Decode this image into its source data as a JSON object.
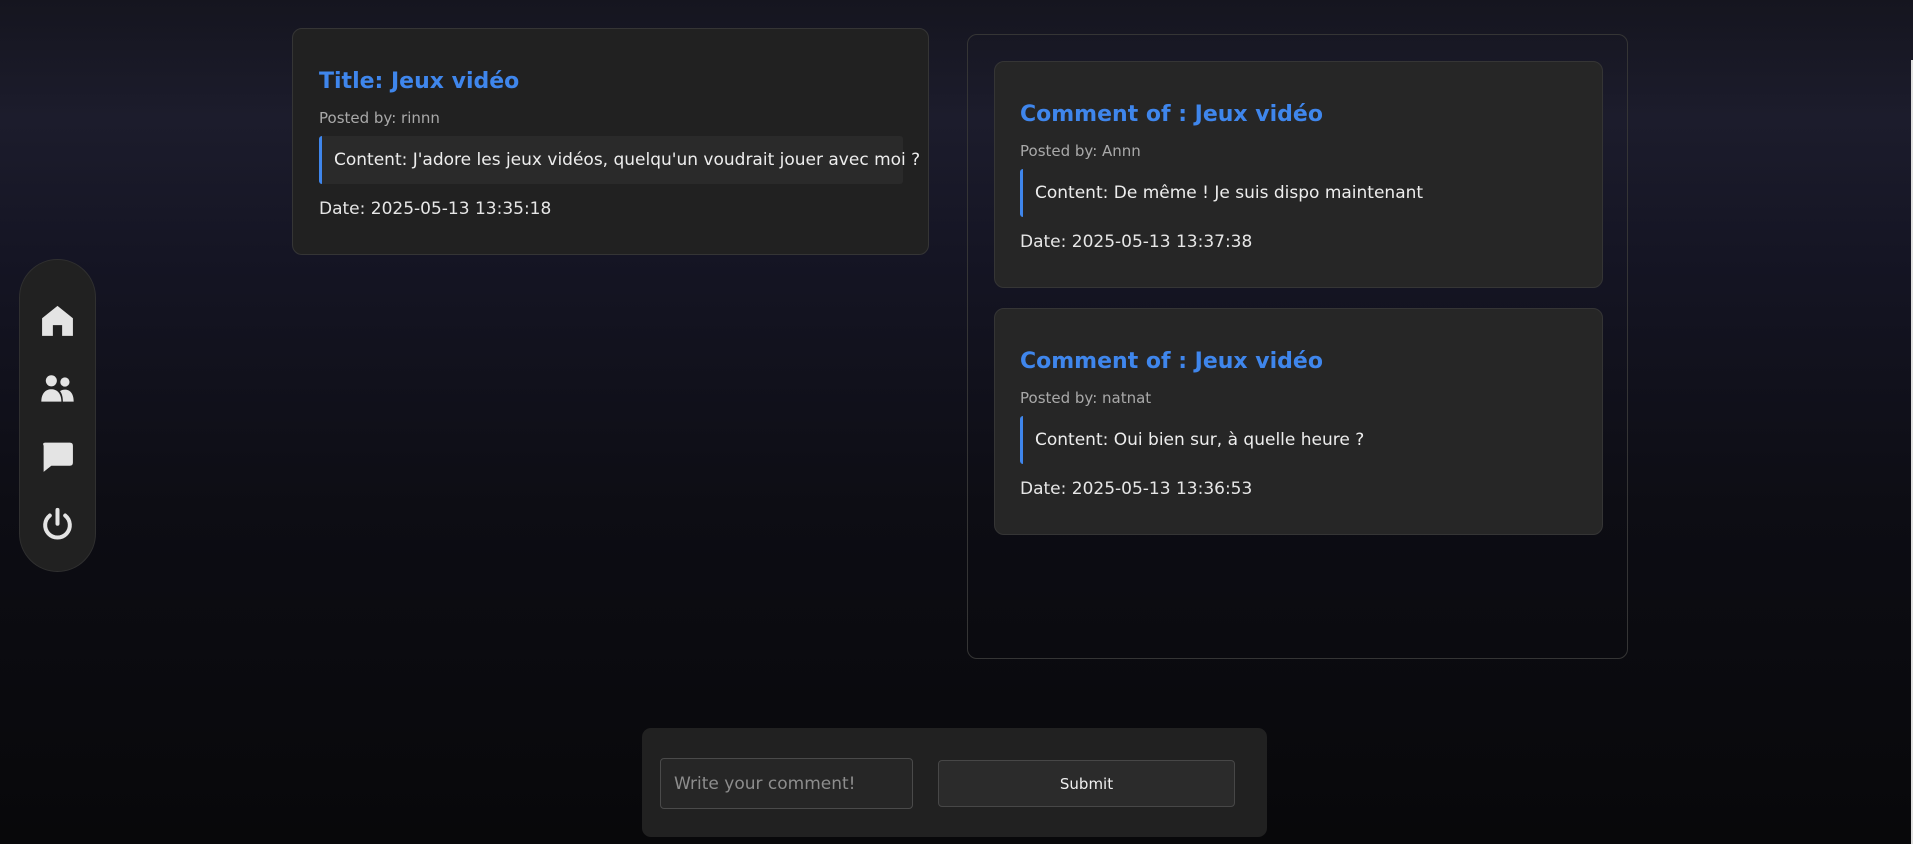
{
  "nav": {
    "items": [
      {
        "icon": "home-icon"
      },
      {
        "icon": "users-icon"
      },
      {
        "icon": "chat-icon"
      },
      {
        "icon": "power-icon"
      }
    ]
  },
  "post": {
    "title": "Title: Jeux vidéo",
    "posted_by": "Posted by: rinnn",
    "content": "Content: J'adore les jeux vidéos, quelqu'un voudrait jouer avec moi ?",
    "date": "Date: 2025-05-13 13:35:18"
  },
  "comments": [
    {
      "title": "Comment of : Jeux vidéo",
      "posted_by": "Posted by: Annn",
      "content": "Content: De même ! Je suis dispo maintenant",
      "date": "Date: 2025-05-13 13:37:38"
    },
    {
      "title": "Comment of : Jeux vidéo",
      "posted_by": "Posted by: natnat",
      "content": "Content: Oui bien sur, à quelle heure ?",
      "date": "Date: 2025-05-13 13:36:53"
    }
  ],
  "form": {
    "placeholder": "Write your comment!",
    "submit_label": "Submit"
  },
  "colors": {
    "accent": "#3f86ec",
    "card": "#212121"
  }
}
